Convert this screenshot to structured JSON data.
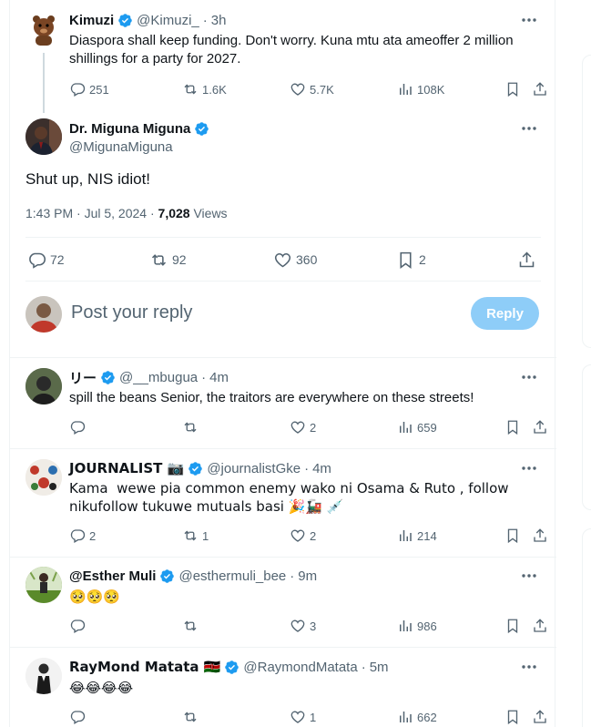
{
  "parent_tweet": {
    "name": "Kimuzi",
    "handle": "@Kimuzi_",
    "sep": "·",
    "time": "3h",
    "text": "Diaspora shall keep funding. Don't worry. Kuna mtu ata ameoffer 2 million shillings for a party for 2027.",
    "replies": "251",
    "retweets": "1.6K",
    "likes": "5.7K",
    "views": "108K"
  },
  "main_tweet": {
    "name": "Dr. Miguna Miguna",
    "handle": "@MigunaMiguna",
    "text": "Shut up, NIS idiot!",
    "time": "1:43 PM · Jul 5, 2024 · ",
    "views_count": "7,028",
    "views_label": " Views",
    "replies": "72",
    "retweets": "92",
    "likes": "360",
    "bookmarks": "2"
  },
  "composer": {
    "placeholder": "Post your reply",
    "button": "Reply"
  },
  "replies": [
    {
      "name": "リー",
      "handle": "@__mbugua",
      "sep": "·",
      "time": "4m",
      "text": "spill the beans Senior, the traitors are everywhere on these streets!",
      "replies": "",
      "retweets": "",
      "likes": "2",
      "views": "659"
    },
    {
      "name": "JOURNALIST 📷",
      "handle": "@journalistGke",
      "sep": "·",
      "time": "4m",
      "text": "Kama  wewe pia common enemy wako ni Osama & Ruto , follow nikufollow tukuwe mutuals basi 🎉🚂 💉",
      "replies": "2",
      "retweets": "1",
      "likes": "2",
      "views": "214"
    },
    {
      "name": "@Esther Muli",
      "handle": "@esthermuli_bee",
      "sep": "·",
      "time": "9m",
      "text": "🥺🥺🥺",
      "replies": "",
      "retweets": "",
      "likes": "3",
      "views": "986"
    },
    {
      "name": "RayMond Matata 🇰🇪",
      "handle": "@RaymondMatata",
      "sep": "·",
      "time": "5m",
      "text": "😂😂😂😂",
      "replies": "",
      "retweets": "",
      "likes": "1",
      "views": "662"
    }
  ],
  "colors": {
    "accent": "#1d9bf0",
    "reply_button_disabled": "#8ecdf8",
    "muted_text": "#536471",
    "divider": "#eff3f4"
  }
}
